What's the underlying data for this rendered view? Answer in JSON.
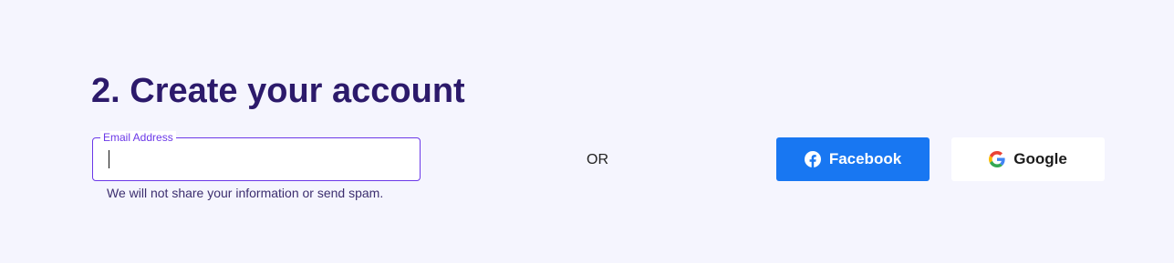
{
  "section": {
    "title": "2. Create your account"
  },
  "email": {
    "label": "Email Address",
    "value": "",
    "placeholder": "",
    "helper": "We will not share your information or send spam."
  },
  "divider": {
    "label": "OR"
  },
  "social": {
    "facebook": {
      "label": "Facebook",
      "icon": "facebook-icon",
      "color": "#1877f2"
    },
    "google": {
      "label": "Google",
      "icon": "google-icon",
      "color": "#ffffff"
    }
  },
  "colors": {
    "background": "#f5f5fe",
    "title": "#2c1a6b",
    "accent": "#6b38e8"
  }
}
